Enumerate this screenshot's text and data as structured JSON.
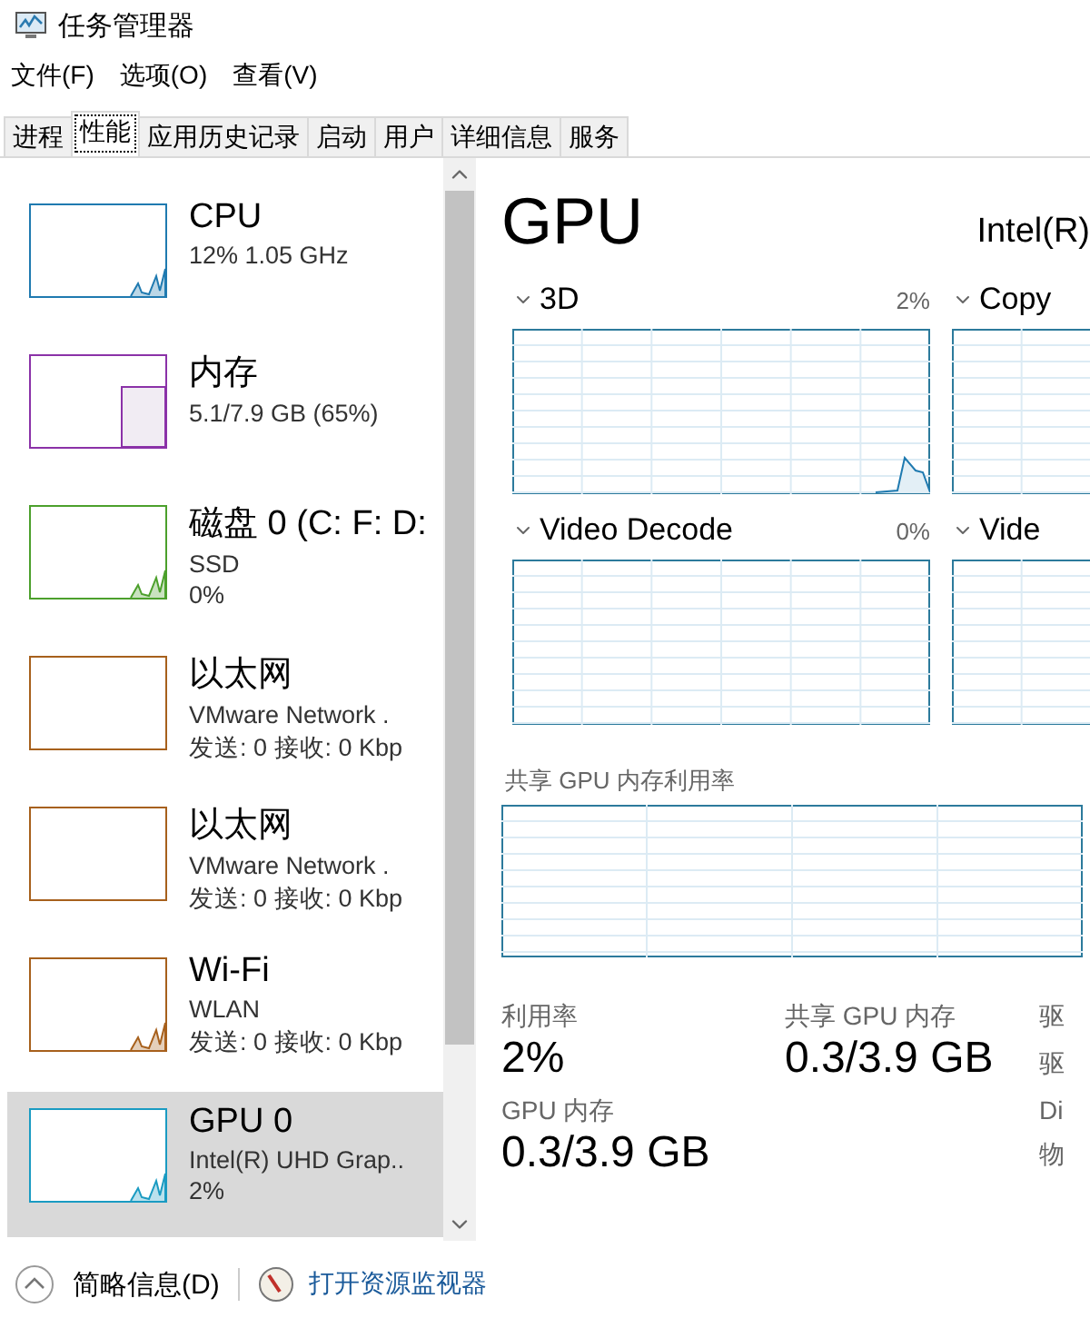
{
  "window": {
    "title": "任务管理器"
  },
  "menu": [
    "文件(F)",
    "选项(O)",
    "查看(V)"
  ],
  "tabs": [
    {
      "label": "进程",
      "selected": false
    },
    {
      "label": "性能",
      "selected": true
    },
    {
      "label": "应用历史记录",
      "selected": false
    },
    {
      "label": "启动",
      "selected": false
    },
    {
      "label": "用户",
      "selected": false
    },
    {
      "label": "详细信息",
      "selected": false
    },
    {
      "label": "服务",
      "selected": false
    }
  ],
  "sidebar": {
    "items": [
      {
        "name": "CPU",
        "lines": [
          "12% 1.05 GHz"
        ],
        "color": "#1f7ab0",
        "kind": "line",
        "selected": false
      },
      {
        "name": "内存",
        "lines": [
          "5.1/7.9 GB (65%)"
        ],
        "color": "#8b32a8",
        "kind": "block",
        "selected": false
      },
      {
        "name": "磁盘 0 (C: F: D:",
        "lines": [
          "SSD",
          "0%"
        ],
        "color": "#4ca02c",
        "kind": "line",
        "selected": false
      },
      {
        "name": "以太网",
        "lines": [
          "VMware Network .",
          "发送: 0 接收: 0 Kbp"
        ],
        "color": "#a7601c",
        "kind": "empty",
        "selected": false
      },
      {
        "name": "以太网",
        "lines": [
          "VMware Network .",
          "发送: 0 接收: 0 Kbp"
        ],
        "color": "#a7601c",
        "kind": "empty",
        "selected": false
      },
      {
        "name": "Wi-Fi",
        "lines": [
          "WLAN",
          "发送: 0 接收: 0 Kbp"
        ],
        "color": "#a7601c",
        "kind": "line",
        "selected": false
      },
      {
        "name": "GPU 0",
        "lines": [
          "Intel(R) UHD Grap..",
          "2%"
        ],
        "color": "#1a9bc2",
        "kind": "line",
        "selected": true
      }
    ]
  },
  "detail": {
    "heading": "GPU",
    "subtitle": "Intel(R)",
    "engines": [
      {
        "label": "3D",
        "reading": "2%",
        "kind": "active"
      },
      {
        "label": "Copy",
        "kind": "idle"
      },
      {
        "label": "Video Decode",
        "reading": "0%",
        "kind": "idle"
      },
      {
        "label": "Vide",
        "kind": "idle"
      }
    ],
    "shared_chart_label": "共享 GPU 内存利用率",
    "stats": [
      {
        "label": "利用率",
        "value": "2%"
      },
      {
        "label": "共享 GPU 内存",
        "value": "0.3/3.9 GB"
      },
      {
        "label": "GPU 内存",
        "value": "0.3/3.9 GB"
      }
    ],
    "side_labels": [
      "驱",
      "驱",
      "Di",
      "物"
    ]
  },
  "footer": {
    "summary": "简略信息(D)",
    "link": "打开资源监视器"
  }
}
